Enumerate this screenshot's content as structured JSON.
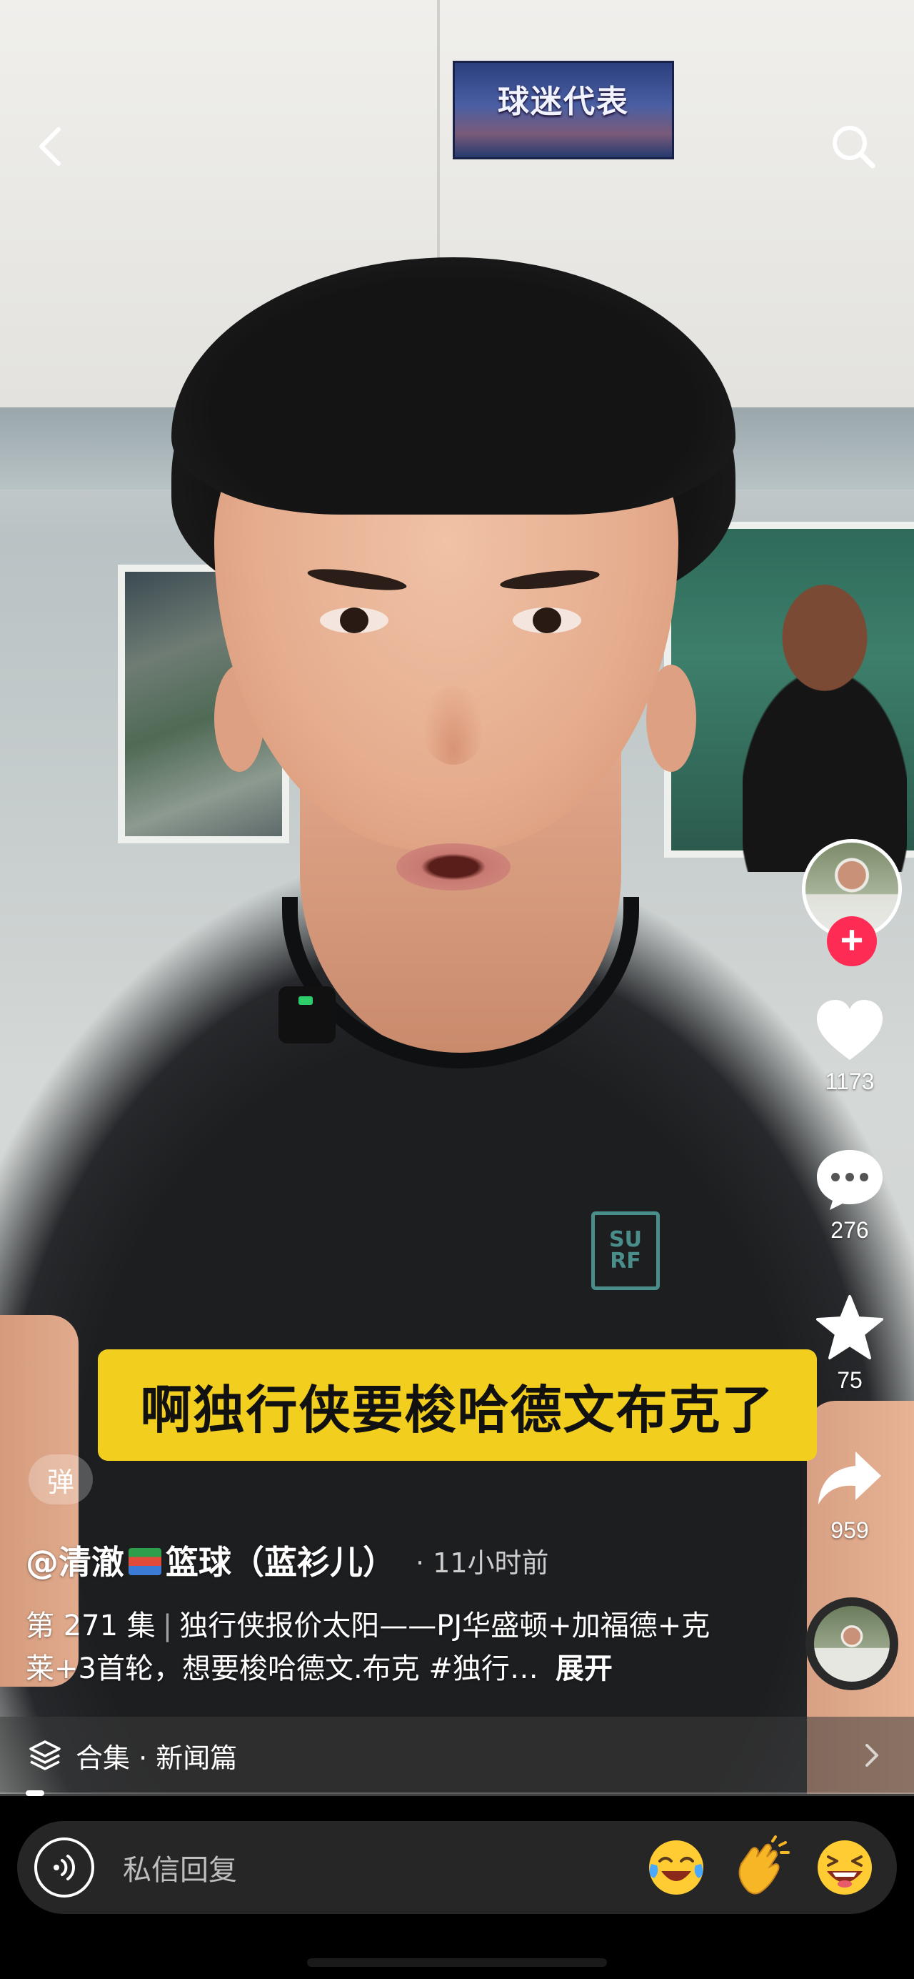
{
  "scene": {
    "sign_text": "球迷代表",
    "shirt_logo_text": "SU\nRF"
  },
  "top_bar": {
    "back_icon": "chevron-left-icon",
    "search_icon": "search-icon"
  },
  "caption": "啊独行侠要梭哈德文布克了",
  "rail": {
    "like_count": "1173",
    "comment_count": "276",
    "favorite_count": "75",
    "share_count": "959",
    "follow_symbol": "+"
  },
  "danmu_label": "弹",
  "post": {
    "author_prefix": "@清澈",
    "author_suffix": "篮球（蓝衫儿）",
    "time_ago": "· 11小时前",
    "episode": "第 271 集",
    "separator": "|",
    "description": "独行侠报价太阳——PJ华盛顿+加福德+克莱+3首轮，想要梭哈德文.布克 #独行…",
    "expand_label": "展开"
  },
  "collection": {
    "label": "合集 · 新闻篇",
    "icon": "layers-icon",
    "arrow_icon": "chevron-right-icon"
  },
  "progress": {
    "fraction": 0.02
  },
  "reply": {
    "placeholder": "私信回复",
    "voice_icon": "voice-icon",
    "emojis": [
      "laugh-tears-emoji",
      "clap-emoji",
      "grin-squint-emoji"
    ]
  },
  "colors": {
    "caption_bg": "#f2cf1f",
    "follow_red": "#fe2c55",
    "reply_bg": "#262626"
  }
}
